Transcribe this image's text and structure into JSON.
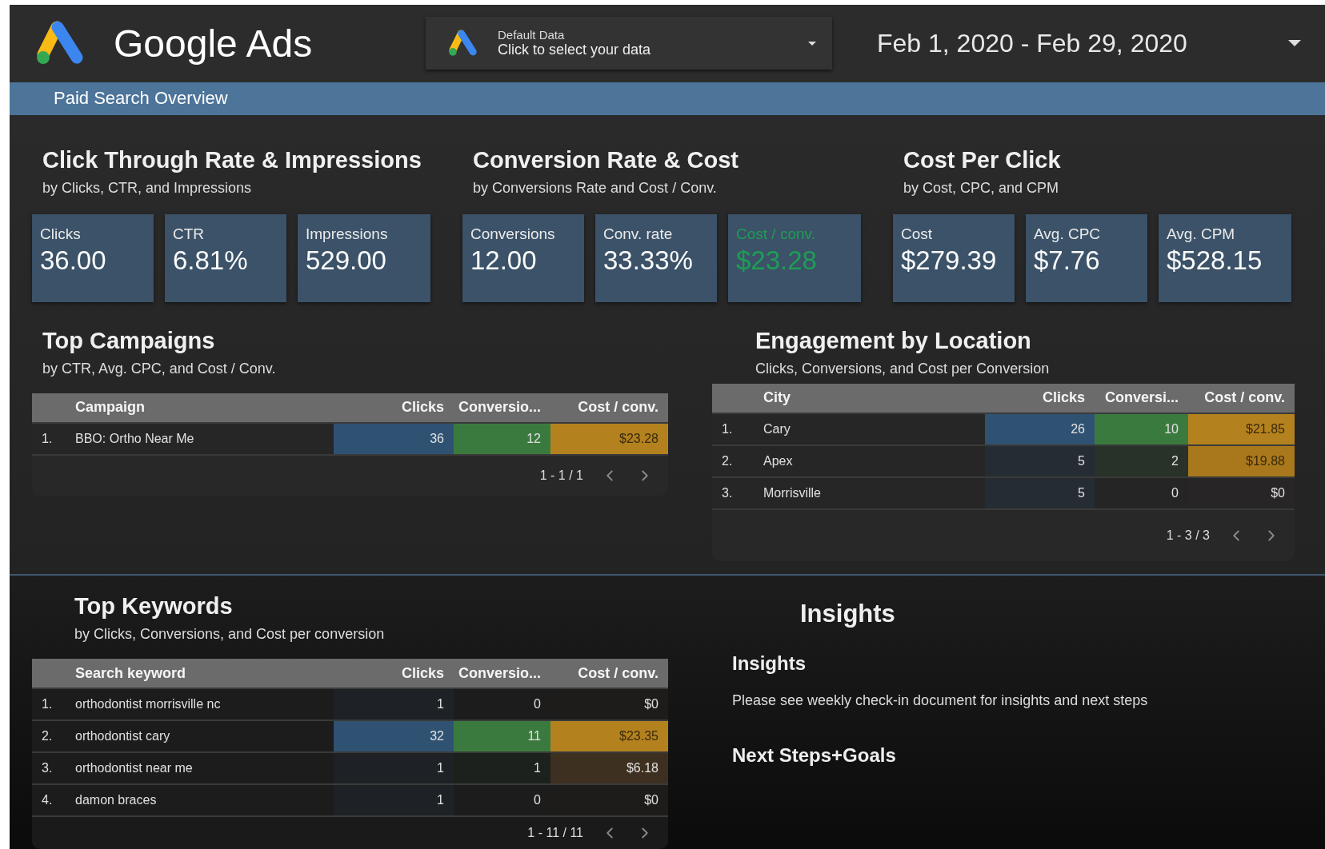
{
  "header": {
    "brand": "Google Ads",
    "data_selector": {
      "label": "Default Data",
      "value": "Click to select your data"
    },
    "date_range": "Feb 1, 2020 - Feb 29, 2020"
  },
  "page_bar": {
    "title": "Paid Search Overview"
  },
  "scorecard_groups": [
    {
      "title": "Click Through Rate & Impressions",
      "subtitle": "by Clicks, CTR, and Impressions",
      "cards": [
        {
          "label": "Clicks",
          "value": "36.00"
        },
        {
          "label": "CTR",
          "value": "6.81%"
        },
        {
          "label": "Impressions",
          "value": "529.00"
        }
      ]
    },
    {
      "title": "Conversion Rate & Cost",
      "subtitle": "by Conversions Rate and Cost / Conv.",
      "cards": [
        {
          "label": "Conversions",
          "value": "12.00"
        },
        {
          "label": "Conv. rate",
          "value": "33.33%"
        },
        {
          "label": "Cost / conv.",
          "value": "$23.28",
          "color": "#1f9d55"
        }
      ]
    },
    {
      "title": "Cost Per Click",
      "subtitle": "by Cost, CPC, and CPM",
      "cards": [
        {
          "label": "Cost",
          "value": "$279.39"
        },
        {
          "label": "Avg. CPC",
          "value": "$7.76"
        },
        {
          "label": "Avg. CPM",
          "value": "$528.15"
        }
      ]
    }
  ],
  "top_campaigns": {
    "title": "Top Campaigns",
    "subtitle": "by CTR, Avg. CPC, and Cost / Conv.",
    "columns": [
      "",
      "Campaign",
      "Clicks",
      "Conversio...",
      "Cost / conv."
    ],
    "rows": [
      {
        "cells": [
          {
            "text": "1."
          },
          {
            "text": "BBO: Ortho Near Me"
          },
          {
            "text": "36",
            "color": "#2f5273"
          },
          {
            "text": "12",
            "color": "#3b7a3f"
          },
          {
            "text": "$23.28",
            "color": "#b3821f"
          }
        ]
      }
    ],
    "pagination": "1 - 1 / 1"
  },
  "engagement_by_location": {
    "title": "Engagement by Location",
    "subtitle": "Clicks, Conversions, and Cost per Conversion",
    "columns": [
      "",
      "City",
      "Clicks",
      "Conversi...",
      "Cost / conv."
    ],
    "rows": [
      {
        "cells": [
          {
            "text": "1."
          },
          {
            "text": "Cary"
          },
          {
            "text": "26",
            "color": "#2f5273"
          },
          {
            "text": "10",
            "color": "#3b7a3f"
          },
          {
            "text": "$21.85",
            "color": "#b3821f"
          }
        ]
      },
      {
        "cells": [
          {
            "text": "2."
          },
          {
            "text": "Apex"
          },
          {
            "text": "5",
            "color": "#262c34"
          },
          {
            "text": "2",
            "color": "#283228"
          },
          {
            "text": "$19.88",
            "color": "#a9781c"
          }
        ]
      },
      {
        "cells": [
          {
            "text": "3."
          },
          {
            "text": "Morrisville"
          },
          {
            "text": "5",
            "color": "#262c34"
          },
          {
            "text": "0",
            "color": "#252525"
          },
          {
            "text": "$0",
            "color": "#272525"
          }
        ]
      }
    ],
    "pagination": "1 - 3 / 3"
  },
  "top_keywords": {
    "title": "Top Keywords",
    "subtitle": "by Clicks, Conversions, and Cost per conversion",
    "columns": [
      "",
      "Search keyword",
      "Clicks",
      "Conversio...",
      "Cost / conv."
    ],
    "rows": [
      {
        "cells": [
          {
            "text": "1."
          },
          {
            "text": "orthodontist morrisville nc"
          },
          {
            "text": "1",
            "color": "#1e2126"
          },
          {
            "text": "0",
            "color": "#1c1c1c"
          },
          {
            "text": "$0",
            "color": "#1e1c1b"
          }
        ]
      },
      {
        "cells": [
          {
            "text": "2."
          },
          {
            "text": "orthodontist cary"
          },
          {
            "text": "32",
            "color": "#2f5273"
          },
          {
            "text": "11",
            "color": "#3b7a3f"
          },
          {
            "text": "$23.35",
            "color": "#b3821f"
          }
        ]
      },
      {
        "cells": [
          {
            "text": "3."
          },
          {
            "text": "orthodontist near me"
          },
          {
            "text": "1",
            "color": "#1e2126"
          },
          {
            "text": "1",
            "color": "#1d211d"
          },
          {
            "text": "$6.18",
            "color": "#3d3020"
          }
        ]
      },
      {
        "cells": [
          {
            "text": "4."
          },
          {
            "text": "damon braces"
          },
          {
            "text": "1",
            "color": "#1e2126"
          },
          {
            "text": "0",
            "color": "#1c1c1c"
          },
          {
            "text": "$0",
            "color": "#1e1c1b"
          }
        ]
      }
    ],
    "pagination": "1 - 11 / 11"
  },
  "insights": {
    "title": "Insights",
    "heading": "Insights",
    "text": "Please see weekly check-in document for insights and next steps",
    "next_heading": "Next Steps+Goals"
  }
}
